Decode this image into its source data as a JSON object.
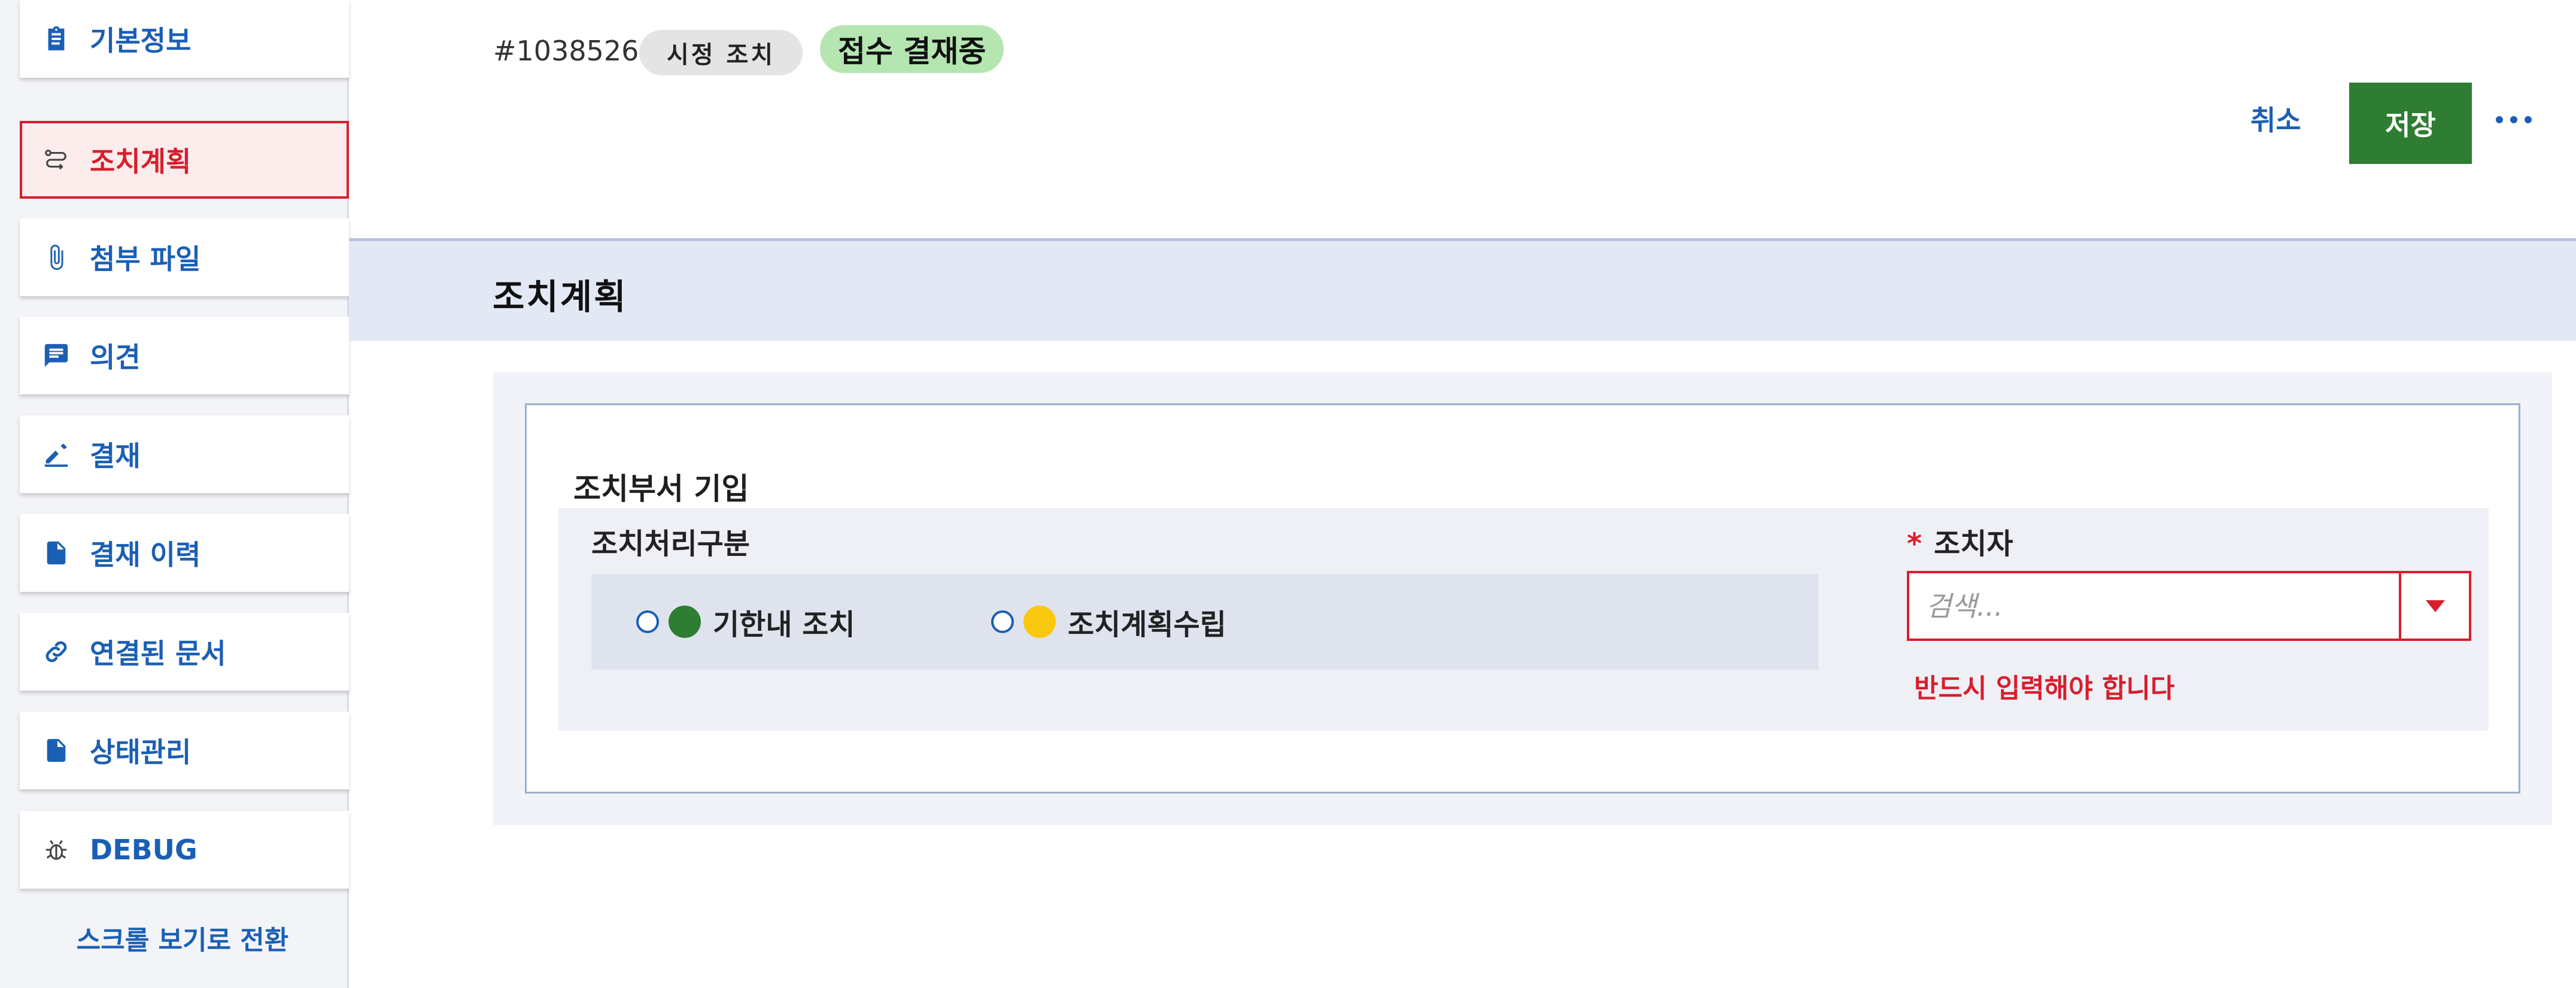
{
  "sidebar": {
    "items": [
      {
        "label": "기본정보",
        "icon": "clipboard-icon"
      },
      {
        "label": "조치계획",
        "icon": "route-icon",
        "active": true
      },
      {
        "label": "첨부 파일",
        "icon": "paperclip-icon"
      },
      {
        "label": "의견",
        "icon": "comment-icon"
      },
      {
        "label": "결재",
        "icon": "pencil-icon"
      },
      {
        "label": "결재 이력",
        "icon": "document-icon"
      },
      {
        "label": "연결된 문서",
        "icon": "link-icon"
      },
      {
        "label": "상태관리",
        "icon": "document-icon"
      },
      {
        "label": "DEBUG",
        "icon": "bug-icon"
      }
    ],
    "scroll_toggle": "스크롤 보기로 전환"
  },
  "header": {
    "doc_id": "#1038526",
    "type_tag": "시정 조치",
    "status_tag": "접수 결재중",
    "cancel_label": "취소",
    "save_label": "저장"
  },
  "section": {
    "title": "조치계획"
  },
  "form": {
    "group_title": "조치부서 기입",
    "type_label": "조치처리구분",
    "options": [
      {
        "label": "기한내 조치",
        "color": "#2e7d32"
      },
      {
        "label": "조치계획수립",
        "color": "#f9c80e"
      }
    ],
    "person_label": "조치자",
    "required_mark": "*",
    "search_placeholder": "검색...",
    "error": "반드시 입력해야 합니다"
  },
  "colors": {
    "accent": "#1a5fb4",
    "error": "#d81e2c",
    "save": "#2e7d32",
    "status_tag": "#b5e5b1"
  }
}
